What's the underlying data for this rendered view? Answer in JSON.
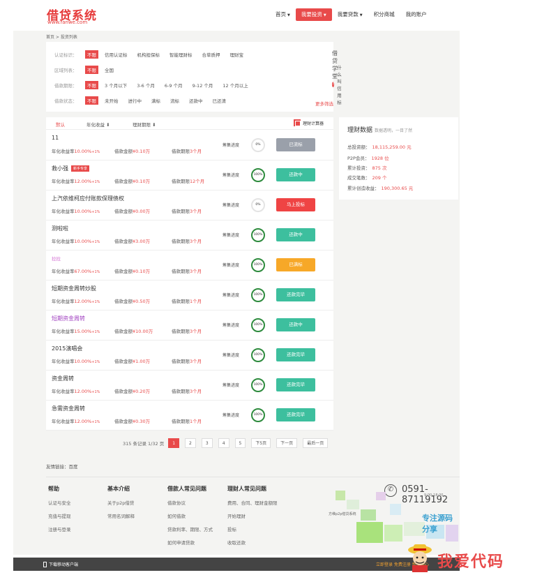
{
  "header": {
    "logo_cn": "借贷系统",
    "logo_url": "www.fanwe.com",
    "nav": [
      {
        "label": "首页",
        "caret": "▼"
      },
      {
        "label": "我要投资",
        "caret": "▼"
      },
      {
        "label": "我要贷款",
        "caret": "▼"
      },
      {
        "label": "积分商城",
        "caret": ""
      },
      {
        "label": "我的账户",
        "caret": ""
      }
    ]
  },
  "breadcrumb": "首页 > 投资列表",
  "filters": [
    {
      "label": "认证标识：",
      "options": [
        "不限",
        "信用认证标",
        "机构担保标",
        "智能理财标",
        "合草质押",
        "理财宝"
      ]
    },
    {
      "label": "区域列表：",
      "options": [
        "不限",
        "全国"
      ]
    },
    {
      "label": "借款期限：",
      "options": [
        "不限",
        "3 个月以下",
        "3-6 个月",
        "6-9 个月",
        "9-12 个月",
        "12 个月以上"
      ]
    },
    {
      "label": "借款状态：",
      "options": [
        "不限",
        "未开始",
        "进行中",
        "满标",
        "流标",
        "还款中",
        "已还清"
      ]
    }
  ],
  "more_filter": "更多筛选",
  "school": {
    "title": "借贷学堂",
    "question": "什么叫信用标"
  },
  "sort": {
    "default": "默认",
    "rate": "年化收益 ⬇",
    "term": "理财期限 ⬇",
    "calculator": "理财计算器"
  },
  "loans": [
    {
      "title": "11",
      "rate": "10.00%",
      "amount": "¥0.10万",
      "term": "3个月",
      "progress": "0%",
      "action": "已流标"
    },
    {
      "title": "救小强",
      "badge": "新手专享",
      "rate": "12.00%",
      "amount": "¥0.10万",
      "term": "12个月",
      "progress": "100%",
      "action": "还款中"
    },
    {
      "title": "上汽依维柯应付账款保理债权",
      "rate": "10.00%",
      "amount": "¥0.00万",
      "term": "3个月",
      "progress": "0%",
      "action": "马上投标"
    },
    {
      "title": "测啦啦",
      "rate": "10.00%",
      "amount": "¥3.00万",
      "term": "3个月",
      "progress": "100%",
      "action": "还款中"
    },
    {
      "title": "拉拉",
      "rate": "67.00%",
      "amount": "¥0.10万",
      "term": "3个月",
      "progress": "100%",
      "action": "已满标"
    },
    {
      "title": "短期资金周转炒股",
      "rate": "12.00%",
      "amount": "¥0.50万",
      "term": "1个月",
      "progress": "100%",
      "action": "还款完毕"
    },
    {
      "title": "短期资金周转",
      "rate": "15.00%",
      "amount": "¥10.00万",
      "term": "3个月",
      "progress": "100%",
      "action": "还款中"
    },
    {
      "title": "2015演唱会",
      "rate": "10.00%",
      "amount": "¥1.00万",
      "term": "3个月",
      "progress": "100%",
      "action": "还款完毕"
    },
    {
      "title": "资金周转",
      "rate": "12.00%",
      "amount": "¥0.20万",
      "term": "3个月",
      "progress": "100%",
      "action": "还款完毕"
    },
    {
      "title": "急需资金周转",
      "rate": "12.00%",
      "amount": "¥0.30万",
      "term": "1个月",
      "progress": "100%",
      "action": "还款完毕"
    }
  ],
  "row_labels": {
    "rate": "年化收益率",
    "rate_suffix": "+1%",
    "amount": "借款金额",
    "term": "借款期限",
    "progress": "筹集进度"
  },
  "pager": {
    "summary": "315 条记录 1/32 页",
    "pages": [
      "1",
      "2",
      "3",
      "4",
      "5"
    ],
    "next5": "下5页",
    "next": "下一页",
    "last": "最后一页"
  },
  "finance": {
    "title": "理财数据",
    "subtitle": "数据透明，一目了然",
    "stats": [
      {
        "label": "总投资额：",
        "value": "18,115,259.00 元"
      },
      {
        "label": "P2P会员：",
        "value": "1928 位"
      },
      {
        "label": "累计投资：",
        "value": "875 次"
      },
      {
        "label": "成交笔数：",
        "value": "209 个"
      },
      {
        "label": "累计创造收益：",
        "value": "190,300.65 元"
      }
    ]
  },
  "friend_links": "友情链接：百度",
  "footer": {
    "columns": [
      {
        "title": "帮助",
        "items": [
          "认证与安全",
          "充值与提现",
          "注册与登录"
        ]
      },
      {
        "title": "基本介绍",
        "items": [
          "关于p2p借贷",
          "常用名词解释"
        ]
      },
      {
        "title": "借款人常见问题",
        "items": [
          "借款协议",
          "如何借款",
          "贷款利率、期限、方式",
          "如何申请贷款"
        ]
      },
      {
        "title": "理财人常见问题",
        "items": [
          "费用、合同、理财金额限",
          "开始理财",
          "投标",
          "收取还款"
        ]
      }
    ],
    "phone": "0591-87119192",
    "hours": "9:00-18:00"
  },
  "bottom_bar": {
    "download": "下载移动客户端",
    "right": "立即登录  免费注册  帮助中心"
  },
  "watermark": {
    "slogan": "专注源码分享",
    "love": "我爱代码",
    "small": "方维p2p借贷系统"
  },
  "colors": {
    "accent": "#e84a4a",
    "green": "#3dbf9e",
    "gray": "#9aa0aa",
    "orange": "#f7a828",
    "ring": "#2e8b3e"
  }
}
